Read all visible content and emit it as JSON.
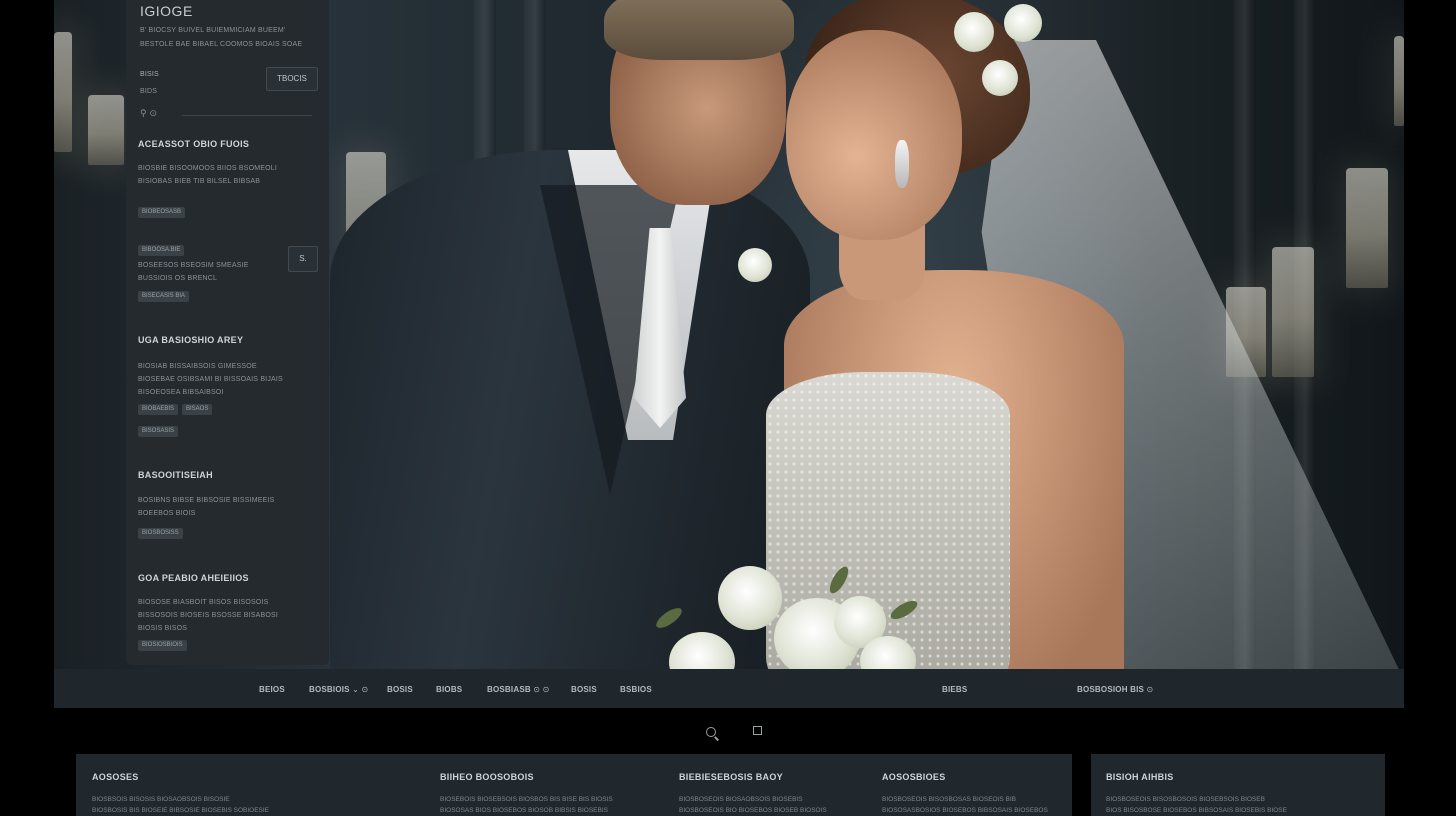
{
  "sidebar": {
    "brand": "IGIOGE",
    "tagline1": "B' BIOCSY BUIVEL BUIEMMICIAM BUEEM'",
    "tagline2": "BESTOLE BAE BIBAEL COOMOS BIOAIS SOAE",
    "tool_label": "BISIS",
    "tool_sub": "BIDS",
    "top_button": "TBOCIS",
    "tool_icons": "⚲ ⊙",
    "sections": [
      {
        "title": "ACEASSOT OBIO FUOIS",
        "lines": [
          "BIOSBIE BISOOMOOS BIIOS BSOMEOLI",
          "BISIOBAS BIEB TIB BILSEL BIBSAB"
        ],
        "chip": "BIOBEOSASB"
      },
      {
        "title": "",
        "lines": [
          "BOSEESOS BSEOSIM SMEASIE",
          "BUSSIOIS OS BRENCL"
        ],
        "chips": [
          "BIBOOSA.BIE",
          "BISECASIS BIA"
        ],
        "button": "S."
      },
      {
        "title": "UGA BASIOSHIO AREY",
        "lines": [
          "BIOSIAB BISSAIBSOIS GIMESSOE",
          "BIOSEBAE OSIBSAMI BI BISSOAIS BIJAIS",
          "BISOEOSEA BIBSAIBSOI"
        ],
        "chips": [
          "BIOBAEBIS",
          "BISAOS"
        ],
        "chip2": "BISOSASIS"
      },
      {
        "title": "BASOOITISEIAH",
        "lines": [
          "BOSIBNS BIBSE BIBSOSIE BISSIMEEIS",
          "BOEEBOS BIOIS"
        ],
        "chip": "BIOSBOSISS"
      },
      {
        "title": "GOA PEABIO AHEIEIIOS",
        "lines": [
          "BIOSOSE BIASBOIT BISOS BISOSOIS",
          "BISSOSOIS BIOSEIS BSOSSE BISABOSI",
          "BIOSIS BISOS"
        ],
        "chip": "BIOSIOSBIOIS"
      }
    ]
  },
  "navbar": {
    "items": [
      "BEIOS",
      "BOSBIOIS",
      "BOSIS",
      "BIOBS",
      "BOSBIASB",
      "BOSIS",
      "BSBIOS",
      "BIEBS",
      "BOSBOSIOH BIS"
    ],
    "suffixes": [
      "",
      "⌄ ⊙",
      "",
      "",
      "⊙ ⊙",
      "",
      "",
      "",
      "⊙"
    ]
  },
  "cards": [
    {
      "title": "AOSOSES",
      "lines": [
        "BIOSBSOIS BISOSIS BIOSAOBSOIS BISOSIE",
        "BIOSBOSIS BIS BIOSEIE BIBSOSIE BIOSEBIS SOBIOESIE"
      ]
    },
    {
      "title": "BIIHEO BOOSOBOIS",
      "lines": [
        "BIOSEBOIS BIOSEBSOIS BIOSBOS BIS BISE BIS BIOSIS",
        "BIOSOSAS BIOS BIOSEBOS BIOSOB BIBSIS BIOSEBIS"
      ]
    },
    {
      "title": "BIEBIESEBOSIS BAOY",
      "lines": [
        "BIOSBOSEOIS BIOSAOBSOIS BIOSEBIS",
        "BIOSBOSEOIS BIO BIOSEBOS BIOSEB BIOSOIS"
      ]
    },
    {
      "title": "AOSOSBIOES",
      "lines": [
        "BIOSBOSEOIS BISOSBOSAS BIOSEOIS BIB",
        "BIOSOSASBOSIOS BIOSEBOS BIBSOSAIS BIOSEBOS"
      ]
    },
    {
      "title": "BISIOH AIHBIS",
      "lines": [
        "BIOSBOSEOIS BISOSBOSOIS BIOSEBSOIS BIOSEB",
        "BIOS BISOSBOSE BIOSEBOS BIBSOSAIS BIOSEBIS BIOSE"
      ]
    }
  ]
}
